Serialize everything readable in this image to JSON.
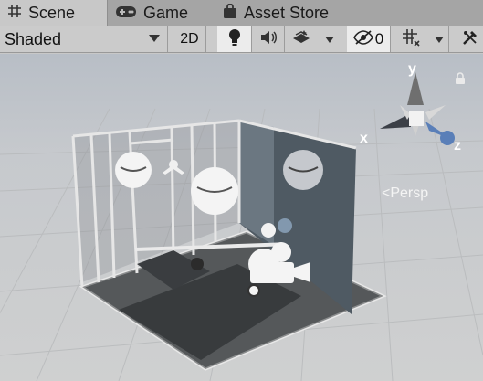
{
  "tabs": [
    {
      "label": "Scene",
      "icon": "grid-icon",
      "active": true
    },
    {
      "label": "Game",
      "icon": "gamepad-icon",
      "active": false
    },
    {
      "label": "Asset Store",
      "icon": "shopping-bag-icon",
      "active": false
    }
  ],
  "toolbar": {
    "draw_mode": "Shaded",
    "mode_2d": "2D",
    "hidden_count": "0"
  },
  "gizmo": {
    "axis_x": "x",
    "axis_y": "y",
    "axis_z": "z",
    "projection": "Persp"
  },
  "colors": {
    "tabbar": "#a5a5a5",
    "toolbar": "#cbcbcb",
    "toggle_on": "#ececec",
    "axis_y": "#6f6f6f",
    "axis_x": "#3c4047",
    "axis_z": "#5a7fb8"
  }
}
